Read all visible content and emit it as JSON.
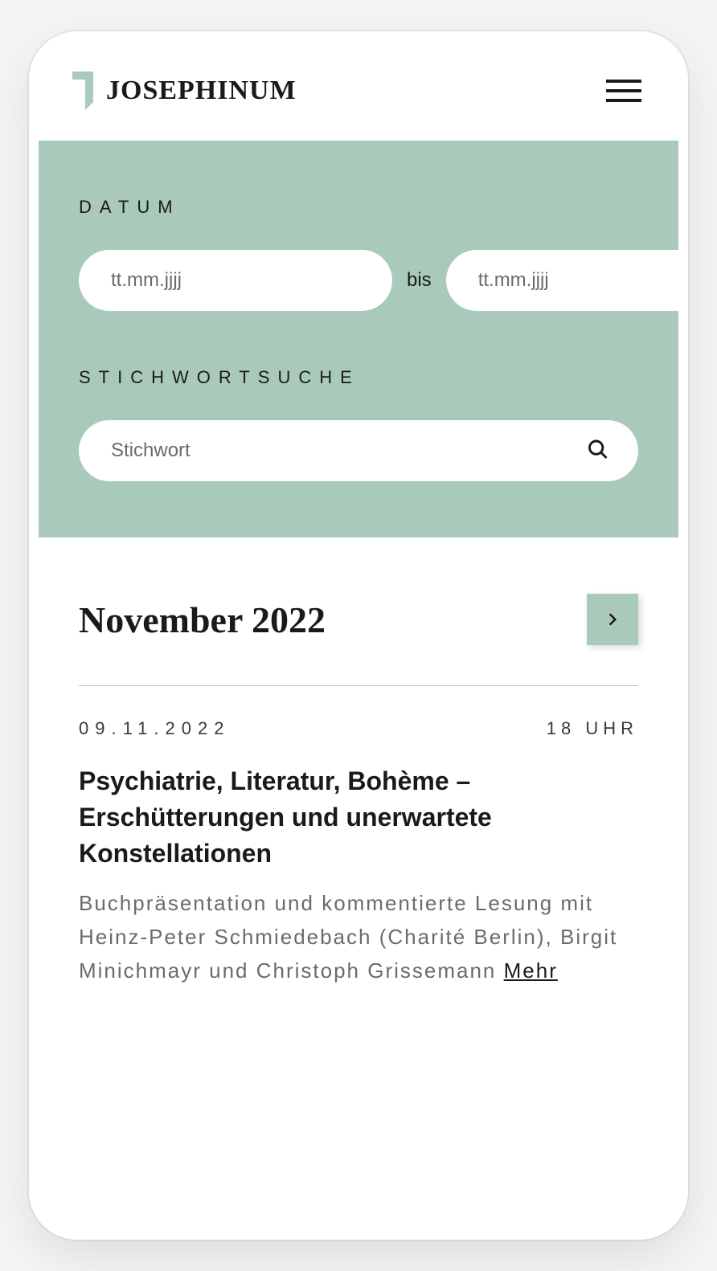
{
  "header": {
    "brand": "JOSEPHINUM"
  },
  "search": {
    "date_label": "DATUM",
    "date_from_placeholder": "tt.mm.jjjj",
    "date_to_placeholder": "tt.mm.jjjj",
    "date_separator": "bis",
    "keyword_label": "STICHWORTSUCHE",
    "keyword_placeholder": "Stichwort"
  },
  "events": {
    "month_title": "November 2022",
    "items": [
      {
        "date": "09.11.2022",
        "time": "18 UHR",
        "title": "Psychiatrie, Literatur, Bohème – Erschütterungen und unerwartete Konstellationen",
        "description": "Buchpräsentation und kommentierte Lesung mit Heinz-Peter Schmiedebach (Charité Berlin), Birgit Minichmayr und Christoph Grissemann ",
        "more_label": "Mehr"
      }
    ]
  },
  "colors": {
    "accent": "#a9c9bb",
    "text": "#1a1a1a",
    "muted": "#6b6b6b"
  }
}
